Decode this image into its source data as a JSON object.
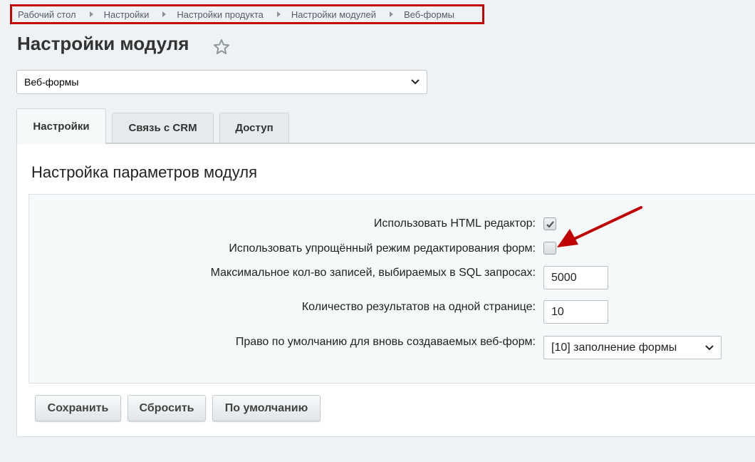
{
  "breadcrumb": [
    "Рабочий стол",
    "Настройки",
    "Настройки продукта",
    "Настройки модулей",
    "Веб-формы"
  ],
  "page": {
    "title": "Настройки модуля"
  },
  "module_select": {
    "value": "Веб-формы"
  },
  "tabs": [
    {
      "label": "Настройки",
      "active": true
    },
    {
      "label": "Связь с CRM",
      "active": false
    },
    {
      "label": "Доступ",
      "active": false
    }
  ],
  "section": {
    "title": "Настройка параметров модуля"
  },
  "fields": {
    "html_editor": {
      "label": "Использовать HTML редактор:",
      "checked": true
    },
    "simple_mode": {
      "label": "Использовать упрощённый режим редактирования форм:",
      "checked": false
    },
    "max_records": {
      "label": "Максимальное кол-во записей, выбираемых в SQL запросах:",
      "value": "5000"
    },
    "results_per_page": {
      "label": "Количество результатов на одной странице:",
      "value": "10"
    },
    "default_right": {
      "label": "Право по умолчанию для вновь создаваемых веб-форм:",
      "value": "[10] заполнение формы"
    }
  },
  "buttons": {
    "save": "Сохранить",
    "reset": "Сбросить",
    "default": "По умолчанию"
  },
  "colors": {
    "highlight": "#c00000",
    "link": "#535c69"
  }
}
